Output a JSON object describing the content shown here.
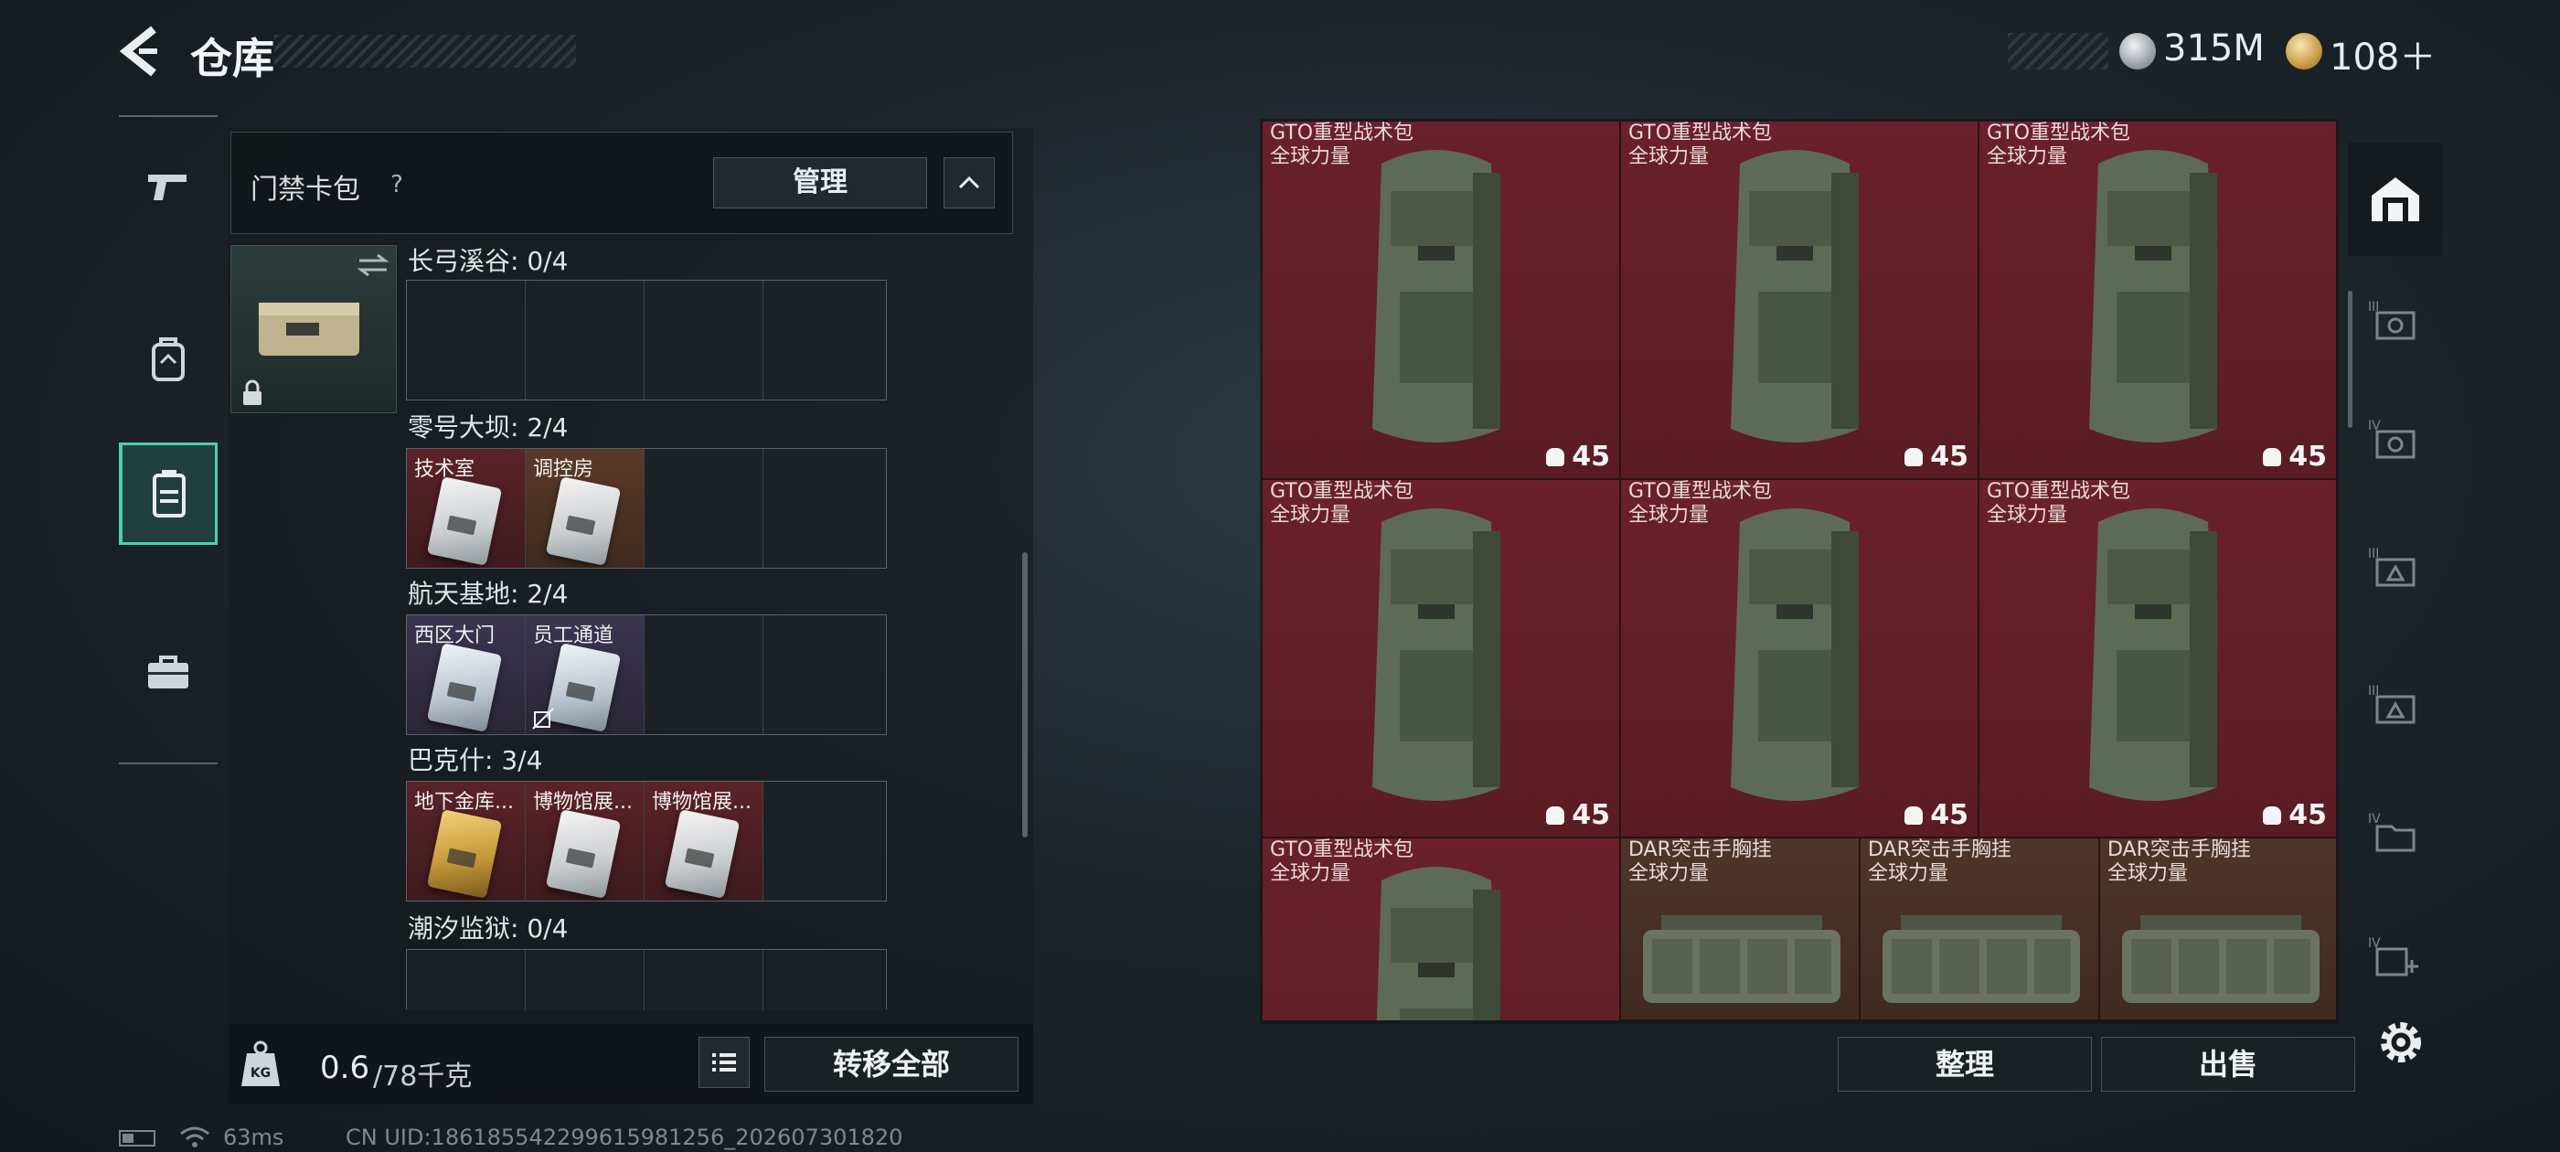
{
  "header": {
    "title": "仓库",
    "currency_silver": "315M",
    "currency_gold": "108＋"
  },
  "left_nav": {
    "items": [
      {
        "icon": "pistol-icon"
      },
      {
        "icon": "backpack-icon"
      },
      {
        "icon": "keycard-pack-icon",
        "active": true
      },
      {
        "icon": "briefcase-icon"
      }
    ]
  },
  "card_pack": {
    "label": "门禁卡包",
    "help": "?",
    "manage_label": "管理",
    "zones": [
      {
        "name": "长弓溪谷: 0/4",
        "slots": [
          "",
          "",
          "",
          ""
        ]
      },
      {
        "name": "零号大坝: 2/4",
        "slots": [
          "技术室",
          "调控房",
          "",
          ""
        ]
      },
      {
        "name": "航天基地: 2/4",
        "slots": [
          "西区大门",
          "员工通道",
          "",
          ""
        ]
      },
      {
        "name": "巴克什: 3/4",
        "slots": [
          "地下金库...",
          "博物馆展...",
          "博物馆展...",
          ""
        ]
      },
      {
        "name": "潮汐监狱: 0/4",
        "slots": [
          "",
          "",
          "",
          ""
        ]
      }
    ]
  },
  "weight": {
    "current": "0.6",
    "max": "/78千克",
    "unit_icon": "KG"
  },
  "buttons": {
    "transfer_all": "转移全部",
    "sort": "整理",
    "sell": "出售"
  },
  "status": {
    "ping": "63ms",
    "uid": "CN UID:186185542299615981256_202607301820"
  },
  "stash": {
    "items": [
      {
        "name": "GTO重型战术包",
        "tag": "全球力量",
        "count": "45",
        "type": "backpack"
      },
      {
        "name": "GTO重型战术包",
        "tag": "全球力量",
        "count": "45",
        "type": "backpack"
      },
      {
        "name": "GTO重型战术包",
        "tag": "全球力量",
        "count": "45",
        "type": "backpack"
      },
      {
        "name": "GTO重型战术包",
        "tag": "全球力量",
        "count": "45",
        "type": "backpack"
      },
      {
        "name": "GTO重型战术包",
        "tag": "全球力量",
        "count": "45",
        "type": "backpack"
      },
      {
        "name": "GTO重型战术包",
        "tag": "全球力量",
        "count": "45",
        "type": "backpack"
      },
      {
        "name": "GTO重型战术包",
        "tag": "全球力量",
        "count": "",
        "type": "backpack"
      },
      {
        "name": "DAR突击手胸挂",
        "tag": "全球力量",
        "count": "",
        "type": "vest"
      },
      {
        "name": "DAR突击手胸挂",
        "tag": "全球力量",
        "count": "",
        "type": "vest"
      },
      {
        "name": "DAR突击手胸挂",
        "tag": "全球力量",
        "count": "",
        "type": "vest"
      }
    ]
  },
  "right_nav": {
    "items": [
      {
        "icon": "storage-home-icon",
        "active": true
      },
      {
        "icon": "tier-3-camera-icon"
      },
      {
        "icon": "tier-4-camera-icon"
      },
      {
        "icon": "tier-3-warning-box-icon"
      },
      {
        "icon": "tier-3-warning-box-icon-2"
      },
      {
        "icon": "tier-4-folder-icon"
      },
      {
        "icon": "tier-4-add-box-icon"
      }
    ]
  }
}
